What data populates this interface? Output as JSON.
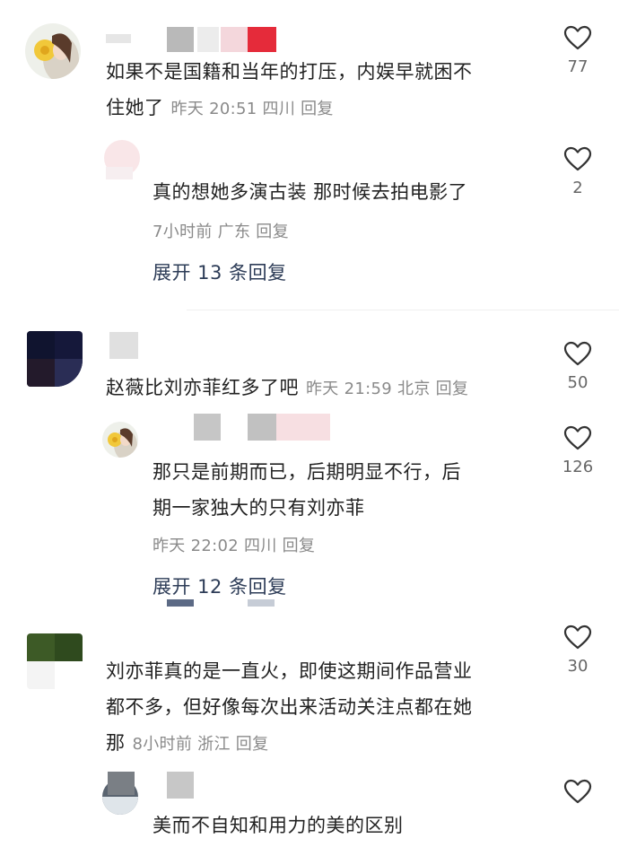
{
  "comments": [
    {
      "text": "如果不是国籍和当年的打压，内娱早就困不住她了",
      "line1": "如果不是国籍和当年的打压，内娱早就困不",
      "line2": "住她了",
      "meta": "昨天 20:51 四川 回复",
      "likes": "77",
      "reply": {
        "text": "真的想她多演古装 那时候去拍电影了",
        "meta": "7小时前 广东 回复",
        "likes": "2"
      },
      "expand": "展开 13 条回复"
    },
    {
      "text": "赵薇比刘亦菲红多了吧",
      "meta": "昨天 21:59 北京 回复",
      "likes": "50",
      "reply": {
        "line1": "那只是前期而已，后期明显不行，后",
        "line2": "期一家独大的只有刘亦菲",
        "meta": "昨天 22:02 四川 回复",
        "likes": "126"
      },
      "expand": "展开 12 条回复"
    },
    {
      "line1": "刘亦菲真的是一直火，即使这期间作品营业",
      "line2": "都不多，但好像每次出来活动关注点都在她",
      "line3": "那",
      "meta": "8小时前 浙江 回复",
      "likes": "30",
      "reply": {
        "text": "美而不自知和用力的美的区别"
      }
    }
  ],
  "icons": {
    "like": "heart-outline-icon"
  }
}
